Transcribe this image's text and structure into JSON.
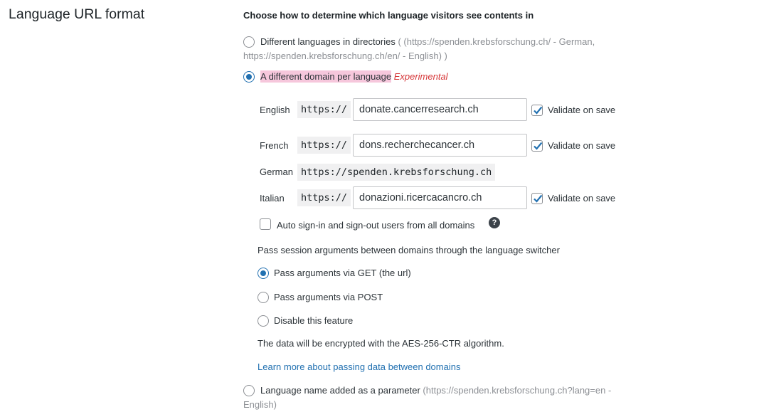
{
  "section_title": "Language URL format",
  "heading": "Choose how to determine which language visitors see contents in",
  "options": {
    "directories": {
      "label": "Different languages in directories",
      "example_line1": "( (https://spenden.krebsforschung.ch/ - German,",
      "example_line2": "https://spenden.krebsforschung.ch/en/ - English) )"
    },
    "domain_per_language": {
      "label": "A different domain per language",
      "tag": "Experimental"
    },
    "parameter": {
      "label": "Language name added as a parameter",
      "example_line1": "(https://spenden.krebsforschung.ch?lang=en -",
      "example_line2": "English)"
    }
  },
  "domains": {
    "protocol": "https://",
    "validate_label": "Validate on save",
    "english": {
      "label": "English",
      "value": "donate.cancerresearch.ch",
      "validate": true
    },
    "french": {
      "label": "French",
      "value": "dons.recherchecancer.ch",
      "validate": true
    },
    "german": {
      "label": "German",
      "fixed_url": "https://spenden.krebsforschung.ch"
    },
    "italian": {
      "label": "Italian",
      "value": "donazioni.ricercacancro.ch",
      "validate": true
    }
  },
  "auto_signin": {
    "label": "Auto sign-in and sign-out users from all domains",
    "checked": false,
    "help_symbol": "?"
  },
  "session": {
    "description": "Pass session arguments between domains through the language switcher",
    "options": [
      {
        "label": "Pass arguments via GET (the url)",
        "selected": true
      },
      {
        "label": "Pass arguments via POST",
        "selected": false
      },
      {
        "label": "Disable this feature",
        "selected": false
      }
    ],
    "encryption_note": "The data will be encrypted with the AES-256-CTR algorithm.",
    "learn_more": "Learn more about passing data between domains"
  },
  "colors": {
    "accent": "#2271b1",
    "highlight": "#f6c7dc",
    "experimental": "#d63638"
  }
}
